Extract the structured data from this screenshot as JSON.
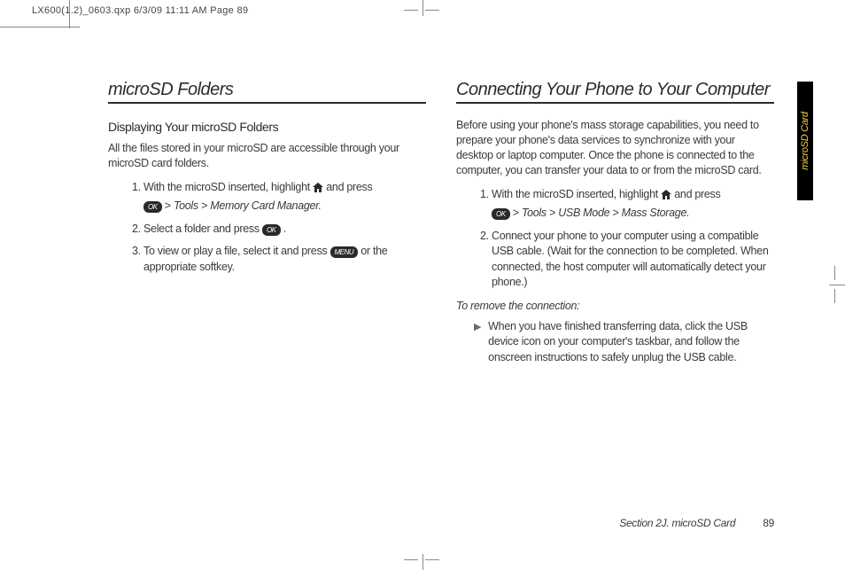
{
  "header": "LX600(1.2)_0603.qxp  6/3/09  11:11 AM  Page 89",
  "tab": "microSD Card",
  "left": {
    "title": "microSD Folders",
    "subtitle": "Displaying Your microSD Folders",
    "intro": "All the files stored in your microSD are accessible through your microSD card folders.",
    "step1_a": "With the microSD inserted, highlight ",
    "step1_b": " and press",
    "step1_path": " Tools > Memory Card Manager.",
    "step2_a": "Select a folder and press ",
    "step2_b": ".",
    "step3_a": "To view or play a file, select it and press ",
    "step3_b": " or the appropriate softkey.",
    "ok_label": "OK",
    "menu_label": "MENU"
  },
  "right": {
    "title": "Connecting Your Phone to Your Computer",
    "intro": "Before using your phone's mass storage capabilities, you need to prepare your phone's data services to synchronize with your desktop or laptop computer. Once the phone is connected to the computer, you can transfer your data to or from the microSD card.",
    "step1_a": "With the microSD inserted, highlight ",
    "step1_b": " and press",
    "step1_path": " Tools > USB Mode > Mass Storage.",
    "step2": "Connect your phone to your computer using a compatible USB cable. (Wait for the connection to be completed. When connected, the host computer will automatically detect your phone.)",
    "remove_title": "To remove the connection:",
    "remove_text": "When you have finished transferring data, click the USB device icon on your computer's taskbar, and follow the onscreen instructions to safely unplug the USB cable.",
    "ok_label": "OK"
  },
  "footer": {
    "section": "Section 2J. microSD Card",
    "page": "89"
  }
}
